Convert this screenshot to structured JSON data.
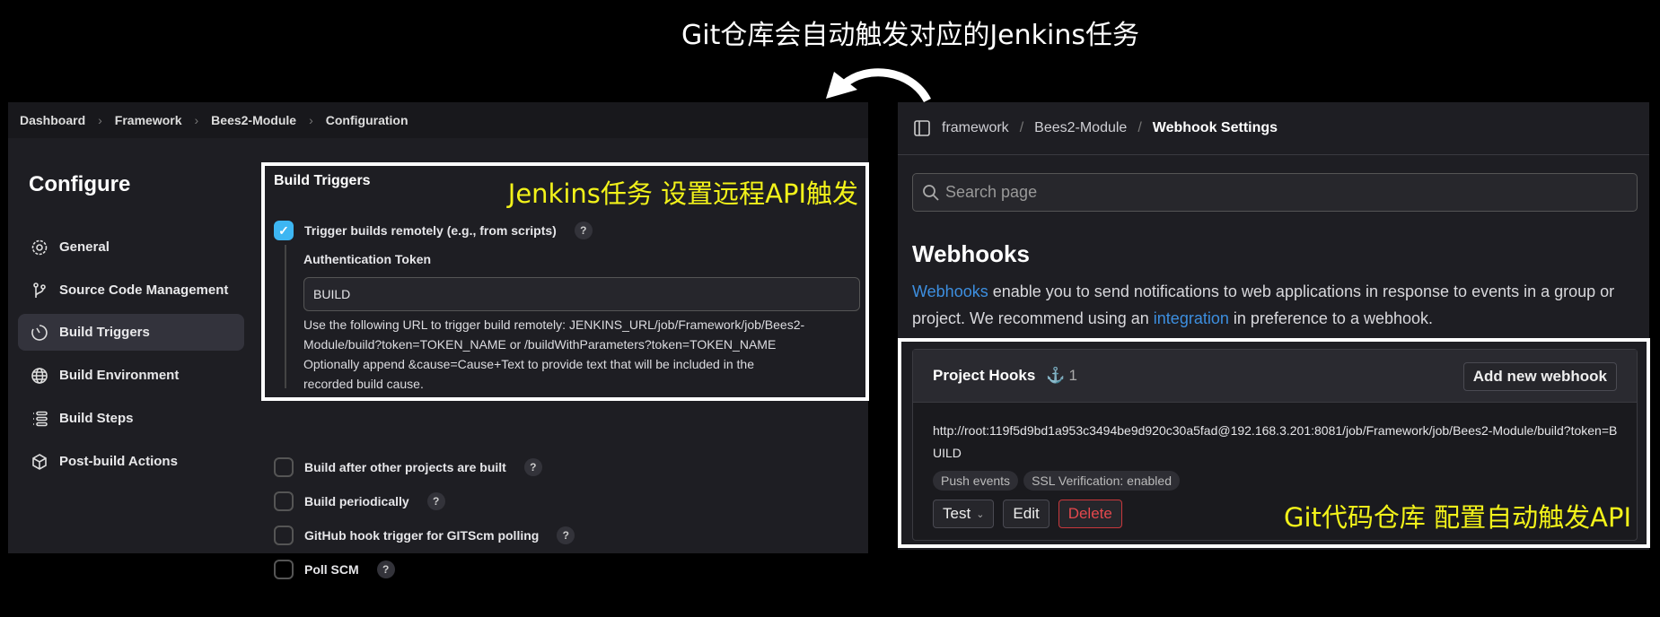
{
  "caption": "Git仓库会自动触发对应的Jenkins任务",
  "jenkins": {
    "breadcrumb": [
      "Dashboard",
      "Framework",
      "Bees2-Module",
      "Configuration"
    ],
    "heading": "Configure",
    "sidebar": [
      {
        "label": "General",
        "icon": "gear-icon"
      },
      {
        "label": "Source Code Management",
        "icon": "branch-icon"
      },
      {
        "label": "Build Triggers",
        "icon": "clock-icon",
        "active": true
      },
      {
        "label": "Build Environment",
        "icon": "globe-icon"
      },
      {
        "label": "Build Steps",
        "icon": "list-icon"
      },
      {
        "label": "Post-build Actions",
        "icon": "package-icon"
      }
    ],
    "section_title": "Build Triggers",
    "annotation": "Jenkins任务 设置远程API触发",
    "trigger_remote": {
      "label": "Trigger builds remotely (e.g., from scripts)",
      "checked": true
    },
    "token_label": "Authentication Token",
    "token_value": "BUILD",
    "help": [
      "Use the following URL to trigger build remotely: JENKINS_URL/job/Framework/job/Bees2-",
      "Module/build?token=TOKEN_NAME or /buildWithParameters?token=TOKEN_NAME",
      "Optionally append &cause=Cause+Text to provide text that will be included in the",
      "recorded build cause."
    ],
    "other_triggers": [
      "Build after other projects are built",
      "Build periodically",
      "GitHub hook trigger for GITScm polling",
      "Poll SCM"
    ],
    "help_mark": "?"
  },
  "gitlab": {
    "breadcrumb": [
      "framework",
      "Bees2-Module",
      "Webhook Settings"
    ],
    "search_placeholder": "Search page",
    "heading": "Webhooks",
    "para": {
      "link1": "Webhooks",
      "t1": " enable you to send notifications to web applications in response to events in a group or project. We recommend using an ",
      "link2": "integration",
      "t2": " in preference to a webhook."
    },
    "hooks_title": "Project Hooks",
    "hooks_count": "1",
    "add_button": "Add new webhook",
    "hook_url": "http://root:119f5d9bd1a953c3494be9d920c30a5fad@192.168.3.201:8081/job/Framework/job/Bees2-Module/build?token=BUILD",
    "badges": [
      "Push events",
      "SSL Verification: enabled"
    ],
    "test_button": "Test",
    "edit_button": "Edit",
    "delete_button": "Delete",
    "annotation": "Git代码仓库 配置自动触发API"
  }
}
